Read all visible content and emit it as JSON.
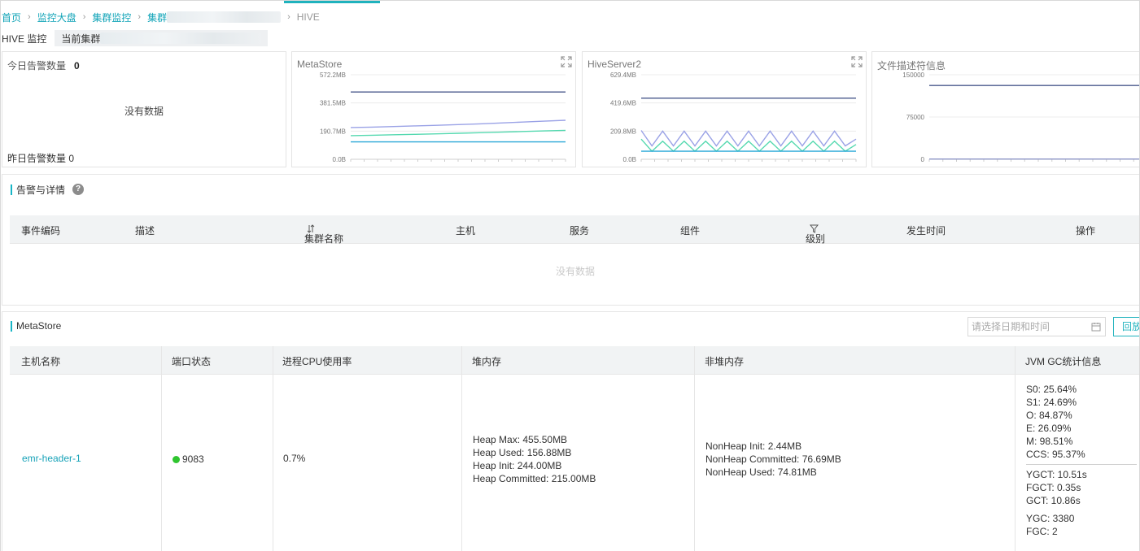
{
  "breadcrumb": {
    "home": "首页",
    "dashboard": "监控大盘",
    "cluster_monitor": "集群监控",
    "cluster_prefix": "集群",
    "current": "HIVE"
  },
  "subheader": {
    "title": "HIVE 监控",
    "cluster_label": "当前集群"
  },
  "alarm_card": {
    "today_label": "今日告警数量",
    "today_count": "0",
    "no_data": "没有数据",
    "yesterday_text": "昨日告警数量 0"
  },
  "charts": [
    {
      "title": "MetaStore",
      "y_ticks": [
        "572.2MB",
        "381.5MB",
        "190.7MB",
        "0.0B"
      ],
      "ylim_mb": [
        0,
        572.2
      ]
    },
    {
      "title": "HiveServer2",
      "y_ticks": [
        "629.4MB",
        "419.6MB",
        "209.8MB",
        "0.0B"
      ],
      "ylim_mb": [
        0,
        629.4
      ]
    },
    {
      "title": "文件描述符信息",
      "y_ticks": [
        "150000",
        "75000",
        "0"
      ],
      "ylim": [
        0,
        150000
      ]
    }
  ],
  "chart_data": [
    {
      "type": "line",
      "title": "MetaStore",
      "ylim": [
        0,
        572.2
      ],
      "y_unit": "MB",
      "grid": true,
      "x": [
        0,
        1,
        2,
        3,
        4,
        5,
        6,
        7,
        8,
        9,
        10
      ],
      "series": [
        {
          "values": [
            455.5,
            455.5,
            455.5,
            455.5,
            455.5,
            455.5,
            455.5,
            455.5,
            455.5,
            455.5,
            455.5
          ],
          "color": "#4a5a8c"
        },
        {
          "values": [
            215,
            218,
            222,
            226,
            230,
            235,
            240,
            246,
            252,
            258,
            264
          ],
          "color": "#9aa2e6"
        },
        {
          "values": [
            160,
            163,
            166,
            169,
            172,
            176,
            180,
            184,
            188,
            192,
            196
          ],
          "color": "#56d9b0"
        },
        {
          "values": [
            118,
            118,
            118,
            118,
            118,
            118,
            118,
            118,
            118,
            118,
            118
          ],
          "color": "#2aa8d8"
        }
      ]
    },
    {
      "type": "line",
      "title": "HiveServer2",
      "ylim": [
        0,
        629.4
      ],
      "y_unit": "MB",
      "grid": true,
      "x": [
        0,
        1,
        2,
        3,
        4,
        5,
        6,
        7,
        8,
        9,
        10,
        11,
        12,
        13,
        14,
        15,
        16,
        17,
        18,
        19,
        20
      ],
      "series": [
        {
          "values": [
            455,
            455,
            455,
            455,
            455,
            455,
            455,
            455,
            455,
            455,
            455,
            455,
            455,
            455,
            455,
            455,
            455,
            455,
            455,
            455,
            455
          ],
          "color": "#4a5a8c"
        },
        {
          "values": [
            215,
            100,
            210,
            100,
            210,
            100,
            210,
            100,
            210,
            100,
            210,
            100,
            210,
            100,
            210,
            100,
            210,
            100,
            210,
            100,
            150
          ],
          "color": "#9aa2e6"
        },
        {
          "values": [
            150,
            60,
            135,
            60,
            135,
            60,
            135,
            60,
            135,
            60,
            135,
            60,
            135,
            60,
            135,
            60,
            135,
            60,
            135,
            60,
            110
          ],
          "color": "#56d9b0"
        },
        {
          "values": [
            60,
            60,
            60,
            60,
            60,
            60,
            60,
            60,
            60,
            60,
            60,
            60,
            60,
            60,
            60,
            60,
            60,
            60,
            60,
            60,
            60
          ],
          "color": "#2aa8d8"
        }
      ]
    },
    {
      "type": "line",
      "title": "文件描述符信息",
      "ylim": [
        0,
        150000
      ],
      "grid": true,
      "x": [
        0,
        1,
        2,
        3,
        4,
        5,
        6,
        7,
        8,
        9,
        10
      ],
      "series": [
        {
          "values": [
            131000,
            131000,
            131000,
            131000,
            131000,
            131000,
            131000,
            131000,
            131000,
            131000,
            131000
          ],
          "color": "#4a5a8c"
        },
        {
          "values": [
            500,
            500,
            500,
            500,
            500,
            500,
            500,
            500,
            500,
            500,
            500
          ],
          "color": "#8e96c8"
        }
      ]
    }
  ],
  "alarm_section": {
    "title": "告警与详情",
    "columns": [
      "事件编码",
      "描述",
      "集群名称",
      "主机",
      "服务",
      "组件",
      "级别",
      "发生时间",
      "操作"
    ],
    "empty_text": "没有数据"
  },
  "metastore_section": {
    "title": "MetaStore",
    "date_placeholder": "请选择日期和时间",
    "replay_label": "回放",
    "columns": [
      "主机名称",
      "端口状态",
      "进程CPU使用率",
      "堆内存",
      "非堆内存",
      "JVM GC统计信息"
    ],
    "row": {
      "host": "emr-header-1",
      "port": "9083",
      "port_status_color": "#2fc52f",
      "cpu": "0.7%",
      "heap": [
        "Heap Max: 455.50MB",
        "Heap Used: 156.88MB",
        "Heap Init: 244.00MB",
        "Heap Committed: 215.00MB"
      ],
      "nonheap": [
        "NonHeap Init: 2.44MB",
        "NonHeap Committed: 76.69MB",
        "NonHeap Used: 74.81MB"
      ],
      "gc_utilization": [
        "S0: 25.64%",
        "S1: 24.69%",
        "O: 84.87%",
        "E: 26.09%",
        "M: 98.51%",
        "CCS: 95.37%"
      ],
      "gc_time": [
        "YGCT: 10.51s",
        "FGCT: 0.35s",
        "GCT: 10.86s"
      ],
      "gc_count": [
        "YGC: 3380",
        "FGC: 2"
      ]
    }
  }
}
